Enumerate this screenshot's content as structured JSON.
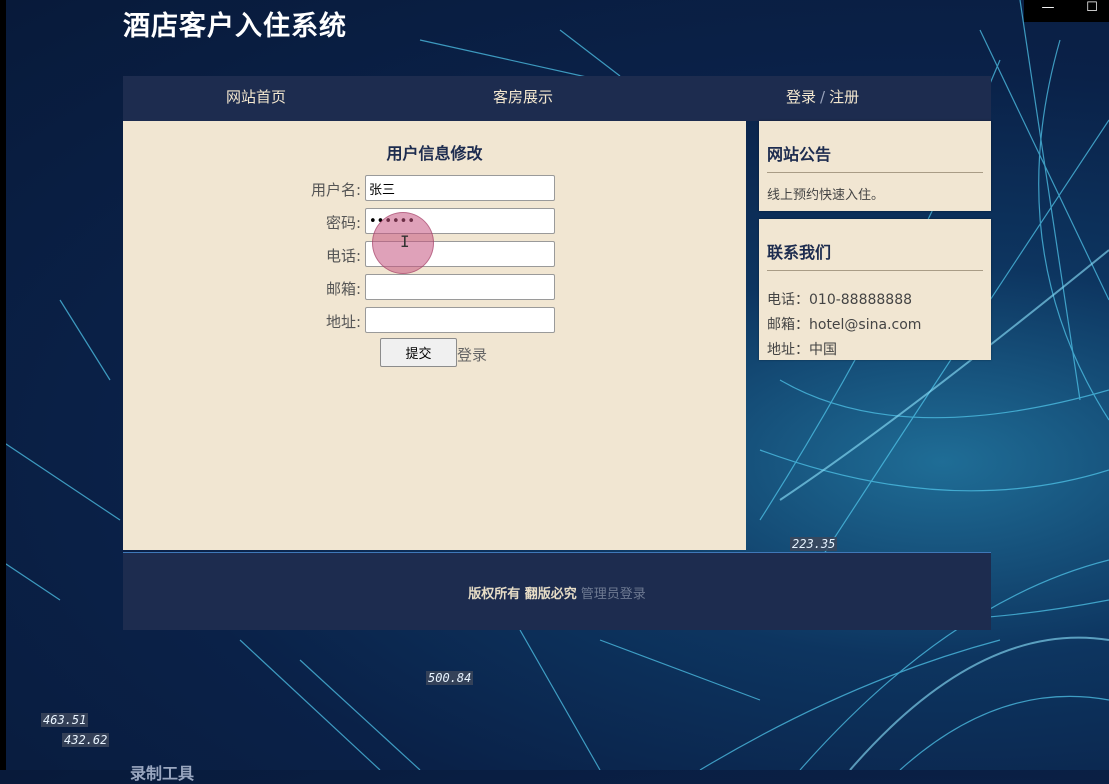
{
  "site": {
    "title": "酒店客户入住系统"
  },
  "window_controls": {
    "minimize": "—",
    "maximize": "☐"
  },
  "nav": {
    "home": "网站首页",
    "rooms": "客房展示",
    "login": "登录",
    "separator": "/",
    "register": "注册"
  },
  "form": {
    "title": "用户信息修改",
    "fields": [
      {
        "label": "用户名:",
        "value": "张三",
        "type": "text"
      },
      {
        "label": "密码:",
        "value": "123456",
        "type": "password"
      },
      {
        "label": "电话:",
        "value": "",
        "type": "text"
      },
      {
        "label": "邮箱:",
        "value": "",
        "type": "text"
      },
      {
        "label": "地址:",
        "value": "",
        "type": "text"
      }
    ],
    "submit_label": "提交",
    "login_link": "登录"
  },
  "cursor": {
    "glyph": "I"
  },
  "notice": {
    "title": "网站公告",
    "text": "线上预约快速入住。"
  },
  "contact": {
    "title": "联系我们",
    "phone": "电话：010-88888888",
    "email": "邮箱：hotel@sina.com",
    "address": "地址：中国"
  },
  "footer": {
    "copyright": "版权所有 翻版必究",
    "admin_link": "管理员登录"
  },
  "overlay_numbers": [
    "223.35",
    "500.84",
    "463.51",
    "432.62"
  ],
  "overlay_tool_label": "录制工具",
  "colors": {
    "nav_bg": "#1d2c4f",
    "panel_bg": "#f1e6d2",
    "title_text": "#1d2c4f",
    "page_bg": "#0a2148"
  }
}
